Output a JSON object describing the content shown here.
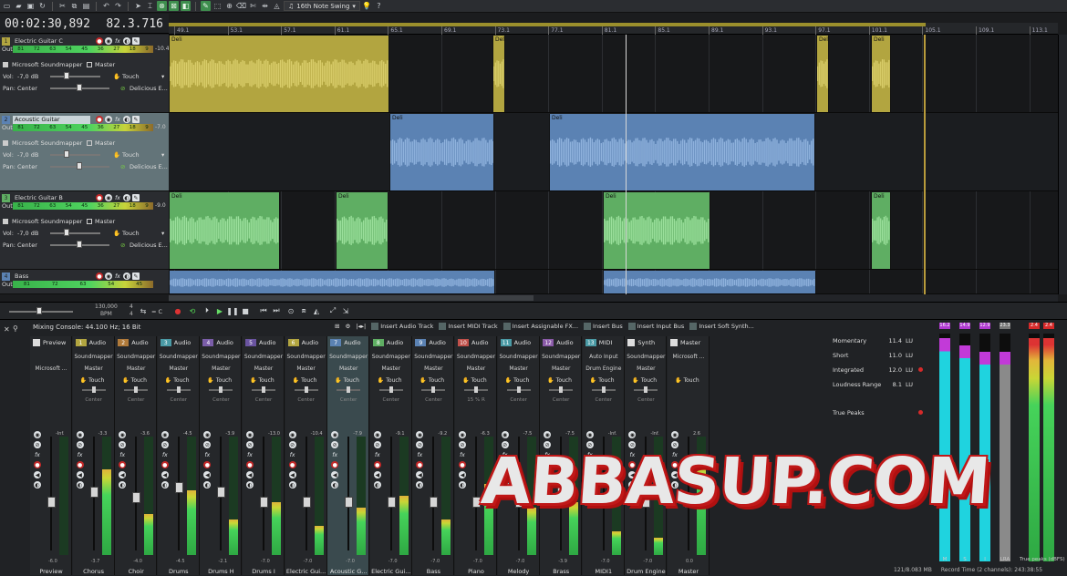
{
  "toolbar": {
    "swing_preset": "16th Note Swing"
  },
  "timecode": {
    "time": "00:02:30,892",
    "position": "82.3.716"
  },
  "ruler_ticks": [
    "49.1",
    "53.1",
    "57.1",
    "61.1",
    "65.1",
    "69.1",
    "73.1",
    "77.1",
    "81.1",
    "85.1",
    "89.1",
    "93.1",
    "97.1",
    "101.1",
    "105.1",
    "109.1",
    "113.1"
  ],
  "tracks": [
    {
      "num": "1",
      "name": "Electric Guitar C",
      "output": "Microsoft Soundmapper",
      "bus": "Master",
      "vol_label": "Vol:",
      "vol": "-7,0 dB",
      "pan_label": "Pan:",
      "pan": "Center",
      "touch": "Touch",
      "fx": "Delicious E...",
      "peak": "-10.4",
      "meter_ticks": [
        "81",
        "72",
        "63",
        "54",
        "45",
        "36",
        "27",
        "18",
        "9"
      ],
      "color": "#b2a540",
      "wave": "#d9cd6a"
    },
    {
      "num": "2",
      "name": "Acoustic Guitar",
      "output": "Microsoft Soundmapper",
      "bus": "Master",
      "vol_label": "Vol:",
      "vol": "-7,0 dB",
      "pan_label": "Pan:",
      "pan": "Center",
      "touch": "Touch",
      "fx": "Delicious E...",
      "peak": "-7.0",
      "meter_ticks": [
        "81",
        "72",
        "63",
        "54",
        "45",
        "36",
        "27",
        "18",
        "9"
      ],
      "color": "#5b82b3",
      "wave": "#8fb2dd"
    },
    {
      "num": "3",
      "name": "Electric Guitar B",
      "output": "Microsoft Soundmapper",
      "bus": "Master",
      "vol_label": "Vol:",
      "vol": "-7,0 dB",
      "pan_label": "Pan:",
      "pan": "Center",
      "touch": "Touch",
      "fx": "Delicious E...",
      "peak": "-9.0",
      "meter_ticks": [
        "81",
        "72",
        "63",
        "54",
        "45",
        "36",
        "27",
        "18",
        "9"
      ],
      "color": "#5fae63",
      "wave": "#9be09c"
    },
    {
      "num": "4",
      "name": "Bass",
      "meter_ticks": [
        "81",
        "72",
        "63",
        "54",
        "45"
      ],
      "color": "#5b82b3",
      "wave": "#8fb2dd"
    }
  ],
  "clip_label": "Deli",
  "transport": {
    "rate": "130,000",
    "rate_unit": "BPM",
    "sig_top": "4",
    "sig_bottom": "4",
    "sync": "= C"
  },
  "mixer": {
    "title": "Mixing Console: 44.100 Hz; 16 Bit",
    "tools": [
      "Insert Audio Track",
      "Insert MIDI Track",
      "Insert Assignable FX...",
      "Insert Bus",
      "Insert Input Bus",
      "Insert Soft Synth..."
    ],
    "strips": [
      {
        "num": "",
        "type": "Preview",
        "line1": "",
        "line2": "",
        "line3": "Microsoft ...",
        "touch": "",
        "pan": "",
        "peak": "-Inf.",
        "db": "-6.0",
        "name": "Preview",
        "color": "#25272a",
        "fill": 0.0,
        "fader": 0.6
      },
      {
        "num": "1",
        "type": "Audio",
        "line1": "Soundmapper",
        "line2": "Master",
        "touch": "Touch",
        "pan": "Center",
        "peak": "-3.3",
        "db": "-3.7",
        "name": "Chorus",
        "color": "#b2a540",
        "fill": 0.72,
        "fader": 0.5
      },
      {
        "num": "2",
        "type": "Audio",
        "line1": "Soundmapper",
        "line2": "Master",
        "touch": "Touch",
        "pan": "Center",
        "peak": "-3.6",
        "db": "-4.0",
        "name": "Choir",
        "color": "#b07a3a",
        "fill": 0.35,
        "fader": 0.55
      },
      {
        "num": "3",
        "type": "Audio",
        "line1": "Soundmapper",
        "line2": "Master",
        "touch": "Touch",
        "pan": "Center",
        "peak": "-4.5",
        "db": "-4.5",
        "name": "Drums",
        "color": "#4a9aa5",
        "fill": 0.55,
        "fader": 0.45
      },
      {
        "num": "4",
        "type": "Audio",
        "line1": "Soundmapper",
        "line2": "Master",
        "touch": "Touch",
        "pan": "Center",
        "peak": "-3.9",
        "db": "-2.1",
        "name": "Drums H",
        "color": "#7a5da8",
        "fill": 0.3,
        "fader": 0.5
      },
      {
        "num": "5",
        "type": "Audio",
        "line1": "Soundmapper",
        "line2": "Master",
        "touch": "Touch",
        "pan": "Center",
        "peak": "-13.0",
        "db": "-7.0",
        "name": "Drums I",
        "color": "#6a54a0",
        "fill": 0.45,
        "fader": 0.6
      },
      {
        "num": "6",
        "type": "Audio",
        "line1": "Soundmapper",
        "line2": "Master",
        "touch": "Touch",
        "pan": "Center",
        "peak": "-10.4",
        "db": "-7.0",
        "name": "Electric Gui...",
        "color": "#b2a540",
        "fill": 0.25,
        "fader": 0.6
      },
      {
        "num": "7",
        "type": "Audio",
        "line1": "Soundmapper",
        "line2": "Master",
        "touch": "Touch",
        "pan": "Center",
        "peak": "-7.9",
        "db": "-7.0",
        "name": "Acoustic G...",
        "color": "#5b82b3",
        "fill": 0.4,
        "fader": 0.6
      },
      {
        "num": "8",
        "type": "Audio",
        "line1": "Soundmapper",
        "line2": "Master",
        "touch": "Touch",
        "pan": "Center",
        "peak": "-9.1",
        "db": "-7.0",
        "name": "Electric Gui...",
        "color": "#5fae63",
        "fill": 0.5,
        "fader": 0.6
      },
      {
        "num": "9",
        "type": "Audio",
        "line1": "Soundmapper",
        "line2": "Master",
        "touch": "Touch",
        "pan": "Center",
        "peak": "-9.2",
        "db": "-7.0",
        "name": "Bass",
        "color": "#5b82b3",
        "fill": 0.3,
        "fader": 0.6
      },
      {
        "num": "10",
        "type": "Audio",
        "line1": "Soundmapper",
        "line2": "Master",
        "touch": "Touch",
        "pan": "15 % R",
        "peak": "-6.3",
        "db": "-7.0",
        "name": "Piano",
        "color": "#c0504a",
        "fill": 0.6,
        "fader": 0.6
      },
      {
        "num": "11",
        "type": "Audio",
        "line1": "Soundmapper",
        "line2": "Master",
        "touch": "Touch",
        "pan": "Center",
        "peak": "-7.5",
        "db": "-7.0",
        "name": "Melody",
        "color": "#4a9aa5",
        "fill": 0.4,
        "fader": 0.6
      },
      {
        "num": "12",
        "type": "Audio",
        "line1": "Soundmapper",
        "line2": "Master",
        "touch": "Touch",
        "pan": "Center",
        "peak": "-7.5",
        "db": "-3.9",
        "name": "Brass",
        "color": "#8a5aa8",
        "fill": 0.45,
        "fader": 0.5
      },
      {
        "num": "13",
        "type": "MIDI",
        "line1": "Auto Input",
        "line2": "Drum Engine",
        "touch": "Touch",
        "pan": "Center",
        "peak": "-Inf.",
        "db": "-7.0",
        "name": "MIDI1",
        "color": "#4a9aa5",
        "fill": 0.2,
        "fader": 0.6
      },
      {
        "num": "",
        "type": "Synth",
        "line1": "Soundmapper",
        "line2": "Master",
        "touch": "Touch",
        "pan": "Center",
        "peak": "-Inf.",
        "db": "-7.0",
        "name": "Drum Engine",
        "color": "#25272a",
        "fill": 0.15,
        "fader": 0.6
      },
      {
        "num": "",
        "type": "Master",
        "line1": "Microsoft ...",
        "line2": "",
        "touch": "Touch",
        "pan": "",
        "peak": "2.6",
        "db": "0.0",
        "name": "Master",
        "color": "#25272a",
        "fill": 0.8,
        "fader": 0.6
      }
    ]
  },
  "loudness": {
    "rows": [
      {
        "label": "Momentary",
        "value": "11.4",
        "unit": "LU",
        "dot": false
      },
      {
        "label": "Short",
        "value": "11.0",
        "unit": "LU",
        "dot": false
      },
      {
        "label": "Integrated",
        "value": "12.0",
        "unit": "LU",
        "dot": true
      },
      {
        "label": "Loudness Range",
        "value": "8.1",
        "unit": "LU",
        "dot": false
      },
      {
        "label": "True Peaks",
        "value": "",
        "unit": "",
        "dot": true
      }
    ],
    "meters": [
      {
        "label": "M",
        "top": "16.2",
        "fill": 0.98,
        "color": "#1fd3df"
      },
      {
        "label": "S",
        "top": "14.9",
        "fill": 0.95,
        "color": "#1fd3df"
      },
      {
        "label": "I",
        "top": "12.9",
        "fill": 0.92,
        "color": "#1fd3df"
      },
      {
        "label": "LRA",
        "top": "23.3",
        "fill": 0.92,
        "color": "#8a8a8a"
      }
    ],
    "true_peak_tops": [
      "2.4",
      "2.4"
    ],
    "true_peak_label": "True peaks (dBFS)"
  },
  "status": {
    "memory": "121/8.083 MB",
    "record_time": "Record Time (2 channels): 243:38:55"
  },
  "watermark": "ABBASUP.COM"
}
